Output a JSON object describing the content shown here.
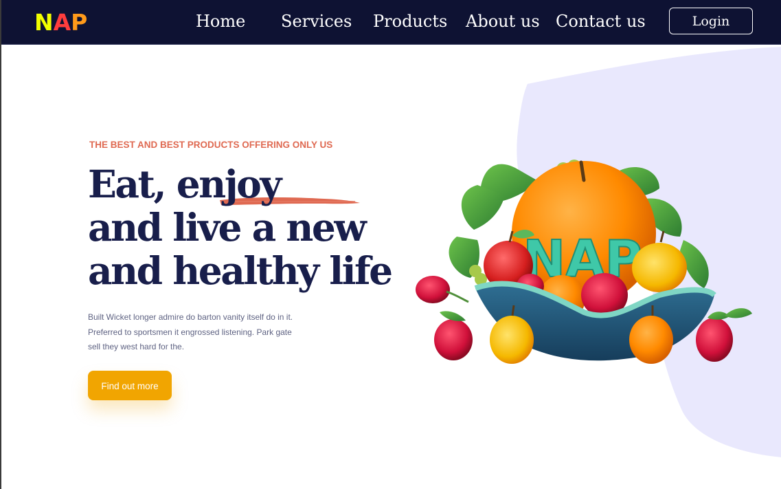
{
  "brand": {
    "logo_letters": [
      "N",
      "A",
      "P"
    ],
    "logo_colors": [
      "#f2ff00",
      "#ff3d3d",
      "#ff9a1a"
    ]
  },
  "nav": {
    "items": [
      {
        "label": "Home"
      },
      {
        "label": "Services"
      },
      {
        "label": "Products"
      },
      {
        "label": "About us"
      },
      {
        "label": "Contact us"
      }
    ],
    "login_label": "Login"
  },
  "hero": {
    "eyebrow": "THE BEST AND BEST PRODUCTS OFFERING ONLY US",
    "headline_lines": [
      "Eat, enjoy",
      "and live a new",
      "and healthy life"
    ],
    "description_lines": [
      "Built Wicket longer admire do barton vanity itself do in it.",
      "Preferred to sportsmen it engrossed listening. Park gate",
      "sell they west hard for the."
    ],
    "cta_label": "Find out more",
    "image_text": "NAP"
  },
  "colors": {
    "nav_bg": "#0e1233",
    "headline": "#181e4b",
    "eyebrow": "#df6951",
    "cta": "#f1a501",
    "blob": "#e9e8fd"
  },
  "icons": {
    "hero_image": "fruit-bowl-illustration",
    "headline_underline": "brush-stroke-decoration"
  }
}
